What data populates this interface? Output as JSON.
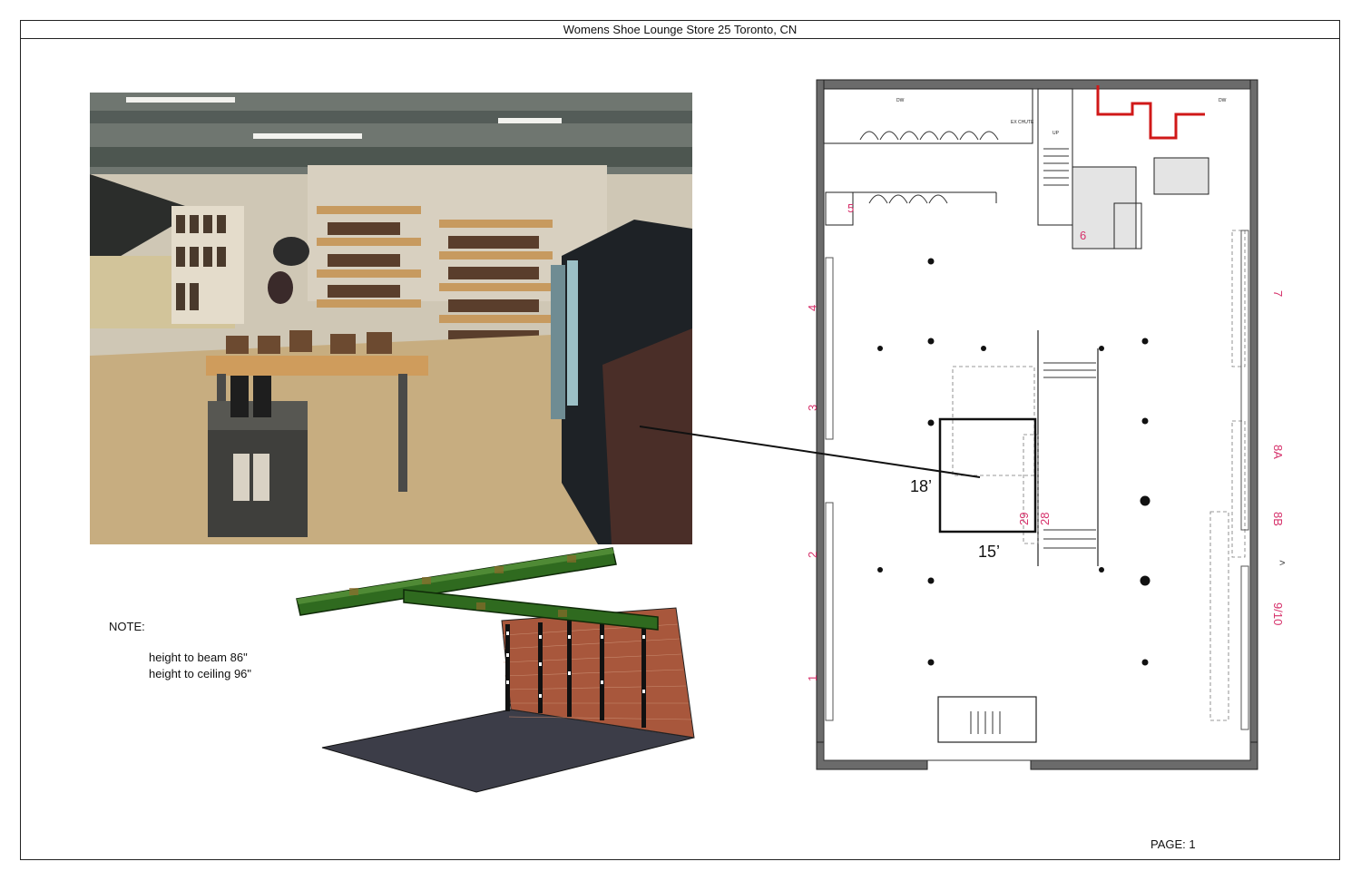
{
  "header": {
    "title": "Womens Shoe Lounge Store 25 Toronto, CN"
  },
  "note": {
    "label": "NOTE:",
    "lines": [
      "height to beam 86\"",
      "height to ceiling 96\""
    ]
  },
  "plan": {
    "zone_labels": [
      "1",
      "2",
      "3",
      "4",
      "5",
      "6",
      "7",
      "8A",
      "8B",
      "9/10",
      "28",
      "29"
    ],
    "dimensions": {
      "depth": "18’",
      "width": "15’"
    },
    "small_labels": {
      "dw": "DW",
      "up": "UP",
      "chute": "EX CHUTE"
    },
    "colors": {
      "zone_label": "#d6306a",
      "highlight": "#d01818",
      "wall": "#555555"
    }
  },
  "footer": {
    "page": "PAGE: 1"
  }
}
